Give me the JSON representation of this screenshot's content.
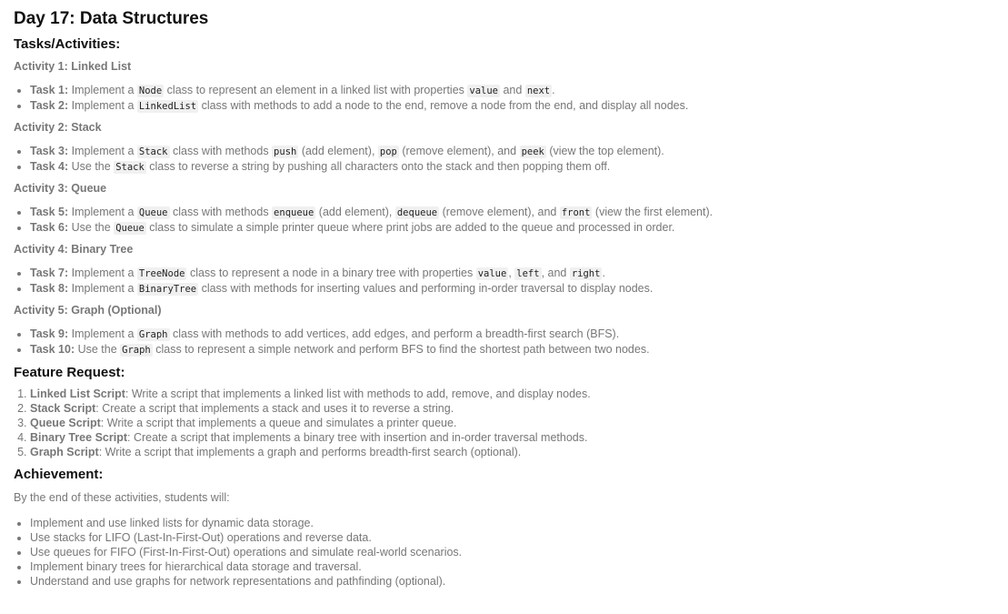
{
  "title": "Day 17: Data Structures",
  "tasks_heading": "Tasks/Activities:",
  "activities": [
    {
      "heading": "Activity 1: Linked List",
      "tasks": [
        {
          "label": "Task 1:",
          "parts": [
            " Implement a ",
            {
              "code": "Node"
            },
            " class to represent an element in a linked list with properties ",
            {
              "code": "value"
            },
            " and ",
            {
              "code": "next"
            },
            "."
          ]
        },
        {
          "label": "Task 2:",
          "parts": [
            " Implement a ",
            {
              "code": "LinkedList"
            },
            " class with methods to add a node to the end, remove a node from the end, and display all nodes."
          ]
        }
      ]
    },
    {
      "heading": "Activity 2: Stack",
      "tasks": [
        {
          "label": "Task 3:",
          "parts": [
            " Implement a ",
            {
              "code": "Stack"
            },
            " class with methods ",
            {
              "code": "push"
            },
            " (add element), ",
            {
              "code": "pop"
            },
            " (remove element), and ",
            {
              "code": "peek"
            },
            " (view the top element)."
          ]
        },
        {
          "label": "Task 4:",
          "parts": [
            " Use the ",
            {
              "code": "Stack"
            },
            " class to reverse a string by pushing all characters onto the stack and then popping them off."
          ]
        }
      ]
    },
    {
      "heading": "Activity 3: Queue",
      "tasks": [
        {
          "label": "Task 5:",
          "parts": [
            " Implement a ",
            {
              "code": "Queue"
            },
            " class with methods ",
            {
              "code": "enqueue"
            },
            " (add element), ",
            {
              "code": "dequeue"
            },
            " (remove element), and ",
            {
              "code": "front"
            },
            " (view the first element)."
          ]
        },
        {
          "label": "Task 6:",
          "parts": [
            " Use the ",
            {
              "code": "Queue"
            },
            " class to simulate a simple printer queue where print jobs are added to the queue and processed in order."
          ]
        }
      ]
    },
    {
      "heading": "Activity 4: Binary Tree",
      "tasks": [
        {
          "label": "Task 7:",
          "parts": [
            " Implement a ",
            {
              "code": "TreeNode"
            },
            " class to represent a node in a binary tree with properties ",
            {
              "code": "value"
            },
            ", ",
            {
              "code": "left"
            },
            ", and ",
            {
              "code": "right"
            },
            "."
          ]
        },
        {
          "label": "Task 8:",
          "parts": [
            " Implement a ",
            {
              "code": "BinaryTree"
            },
            " class with methods for inserting values and performing in-order traversal to display nodes."
          ]
        }
      ]
    },
    {
      "heading": "Activity 5: Graph (Optional)",
      "tasks": [
        {
          "label": "Task 9:",
          "parts": [
            " Implement a ",
            {
              "code": "Graph"
            },
            " class with methods to add vertices, add edges, and perform a breadth-first search (BFS)."
          ]
        },
        {
          "label": "Task 10:",
          "parts": [
            " Use the ",
            {
              "code": "Graph"
            },
            " class to represent a simple network and perform BFS to find the shortest path between two nodes."
          ]
        }
      ]
    }
  ],
  "feature_heading": "Feature Request:",
  "features": [
    {
      "label": "Linked List Script",
      "text": ": Write a script that implements a linked list with methods to add, remove, and display nodes."
    },
    {
      "label": "Stack Script",
      "text": ": Create a script that implements a stack and uses it to reverse a string."
    },
    {
      "label": "Queue Script",
      "text": ": Write a script that implements a queue and simulates a printer queue."
    },
    {
      "label": "Binary Tree Script",
      "text": ": Create a script that implements a binary tree with insertion and in-order traversal methods."
    },
    {
      "label": "Graph Script",
      "text": ": Write a script that implements a graph and performs breadth-first search (optional)."
    }
  ],
  "achievement_heading": "Achievement:",
  "achievement_intro": "By the end of these activities, students will:",
  "achievements": [
    "Implement and use linked lists for dynamic data storage.",
    "Use stacks for LIFO (Last-In-First-Out) operations and reverse data.",
    "Use queues for FIFO (First-In-First-Out) operations and simulate real-world scenarios.",
    "Implement binary trees for hierarchical data storage and traversal.",
    "Understand and use graphs for network representations and pathfinding (optional)."
  ]
}
